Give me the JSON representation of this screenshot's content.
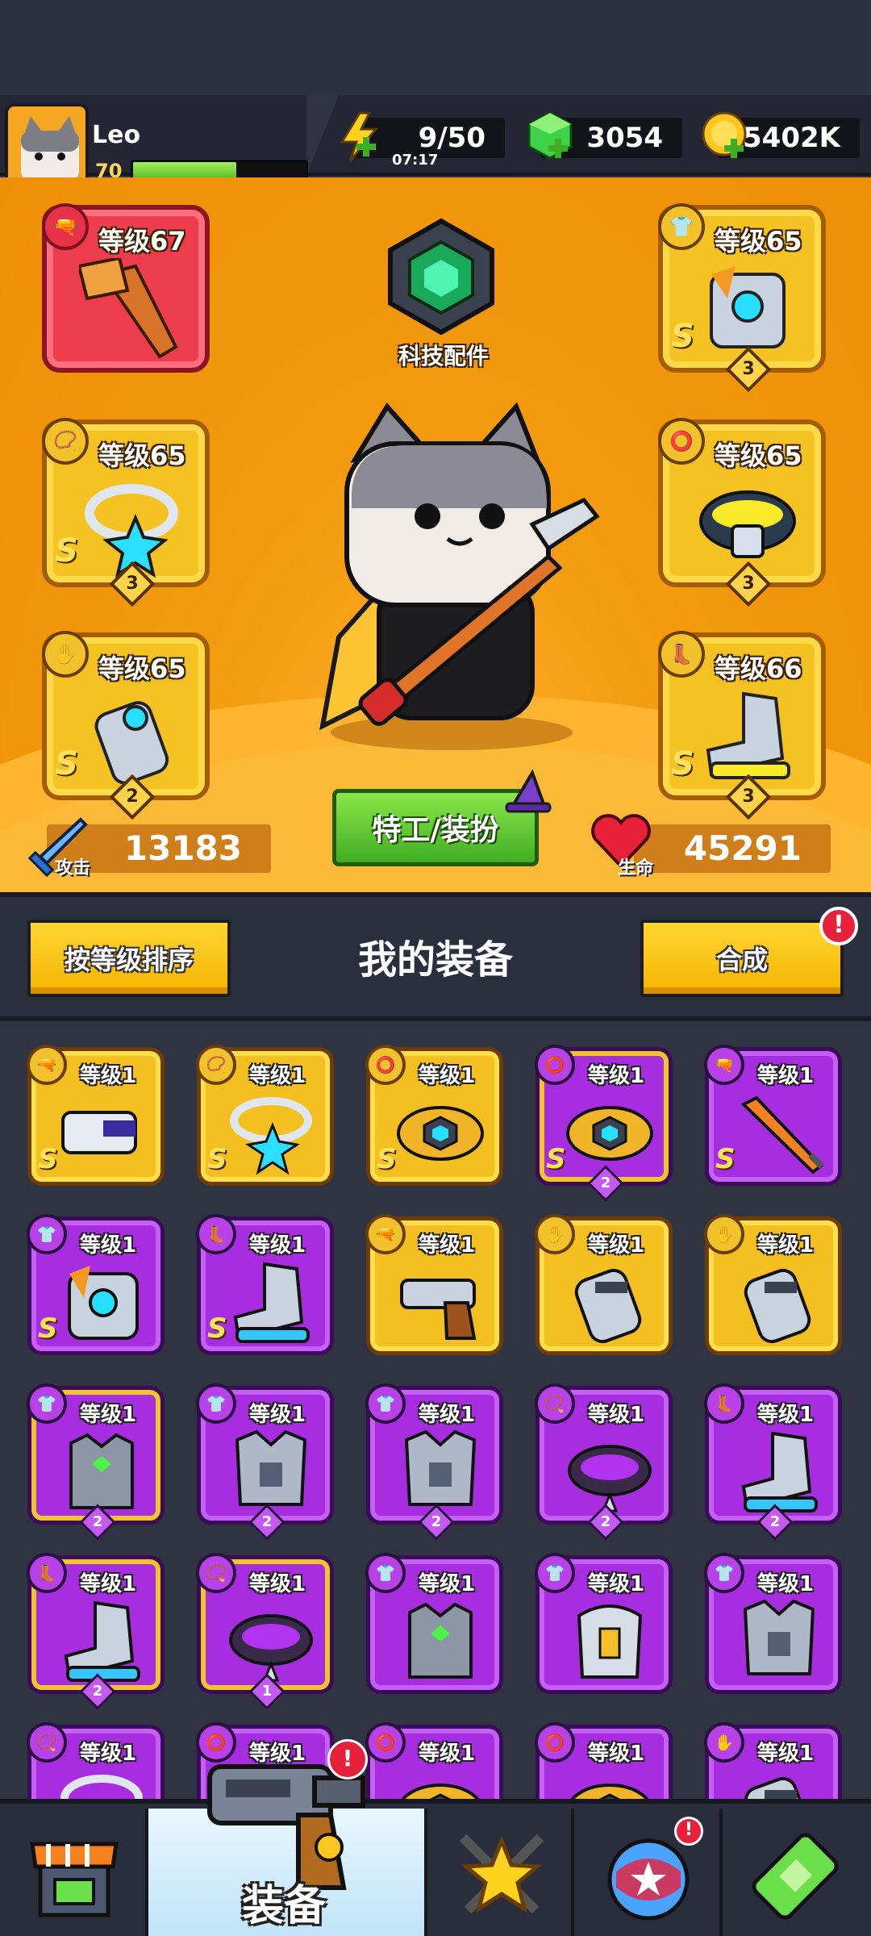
{
  "player": {
    "name": "Leo",
    "level": "70",
    "xp_fraction": 0.6
  },
  "resources": {
    "energy": {
      "value": "9/50",
      "timer": "07:17",
      "icon": "energy-bolt-icon"
    },
    "gems": {
      "value": "3054",
      "icon": "green-gem-icon"
    },
    "coins": {
      "value": "5402K",
      "icon": "gold-coin-icon"
    }
  },
  "hero_slots": [
    {
      "label": "等级67",
      "grade": "",
      "count": "",
      "color": "red",
      "icon": "weapon-slot-icon"
    },
    {
      "label": "等级65",
      "grade": "S",
      "count": "3",
      "color": "yellow",
      "icon": "armor-slot-icon"
    },
    {
      "label": "等级65",
      "grade": "S",
      "count": "3",
      "color": "yellow",
      "icon": "necklace-slot-icon"
    },
    {
      "label": "等级65",
      "grade": "",
      "count": "3",
      "color": "yellow",
      "icon": "belt-slot-icon"
    },
    {
      "label": "等级65",
      "grade": "S",
      "count": "2",
      "color": "yellow",
      "icon": "glove-slot-icon"
    },
    {
      "label": "等级66",
      "grade": "S",
      "count": "3",
      "color": "yellow",
      "icon": "boot-slot-icon"
    }
  ],
  "tech_part": {
    "label": "科技配件"
  },
  "stats": {
    "attack": {
      "label": "攻击",
      "value": "13183"
    },
    "health": {
      "label": "生命",
      "value": "45291"
    }
  },
  "agent_button": {
    "label": "特工/装扮"
  },
  "inventory": {
    "sort_button": "按等级排序",
    "title": "我的装备",
    "merge_button": "合成",
    "alert": "!",
    "items": [
      {
        "label": "等级1",
        "grade": "S",
        "count": "",
        "color": "y"
      },
      {
        "label": "等级1",
        "grade": "S",
        "count": "",
        "color": "y"
      },
      {
        "label": "等级1",
        "grade": "S",
        "count": "",
        "color": "y"
      },
      {
        "label": "等级1",
        "grade": "S",
        "count": "2",
        "color": "py"
      },
      {
        "label": "等级1",
        "grade": "S",
        "count": "",
        "color": "p"
      },
      {
        "label": "等级1",
        "grade": "S",
        "count": "",
        "color": "p"
      },
      {
        "label": "等级1",
        "grade": "S",
        "count": "",
        "color": "p"
      },
      {
        "label": "等级1",
        "grade": "",
        "count": "",
        "color": "y"
      },
      {
        "label": "等级1",
        "grade": "",
        "count": "",
        "color": "y"
      },
      {
        "label": "等级1",
        "grade": "",
        "count": "",
        "color": "y"
      },
      {
        "label": "等级1",
        "grade": "",
        "count": "2",
        "color": "py"
      },
      {
        "label": "等级1",
        "grade": "",
        "count": "2",
        "color": "p"
      },
      {
        "label": "等级1",
        "grade": "",
        "count": "2",
        "color": "p"
      },
      {
        "label": "等级1",
        "grade": "",
        "count": "2",
        "color": "p"
      },
      {
        "label": "等级1",
        "grade": "",
        "count": "2",
        "color": "p"
      },
      {
        "label": "等级1",
        "grade": "",
        "count": "2",
        "color": "py"
      },
      {
        "label": "等级1",
        "grade": "",
        "count": "1",
        "color": "py"
      },
      {
        "label": "等级1",
        "grade": "",
        "count": "",
        "color": "p"
      },
      {
        "label": "等级1",
        "grade": "",
        "count": "",
        "color": "p"
      },
      {
        "label": "等级1",
        "grade": "",
        "count": "",
        "color": "p"
      },
      {
        "label": "等级1",
        "grade": "",
        "count": "",
        "color": "p"
      },
      {
        "label": "等级1",
        "grade": "",
        "count": "",
        "color": "p"
      },
      {
        "label": "等级1",
        "grade": "",
        "count": "",
        "color": "p"
      },
      {
        "label": "等级1",
        "grade": "",
        "count": "",
        "color": "p"
      },
      {
        "label": "等级1",
        "grade": "",
        "count": "",
        "color": "p"
      }
    ]
  },
  "bottom_nav": {
    "active_label": "装备",
    "alert": "!",
    "items": [
      "shop-icon",
      "equipment-gun-icon",
      "battle-star-icon",
      "world-globe-icon",
      "lab-battery-icon"
    ]
  },
  "colors": {
    "accent": "#f39a0d",
    "legendary": "#f4c021",
    "epic": "#a62ee0",
    "alert": "#e8213b"
  }
}
